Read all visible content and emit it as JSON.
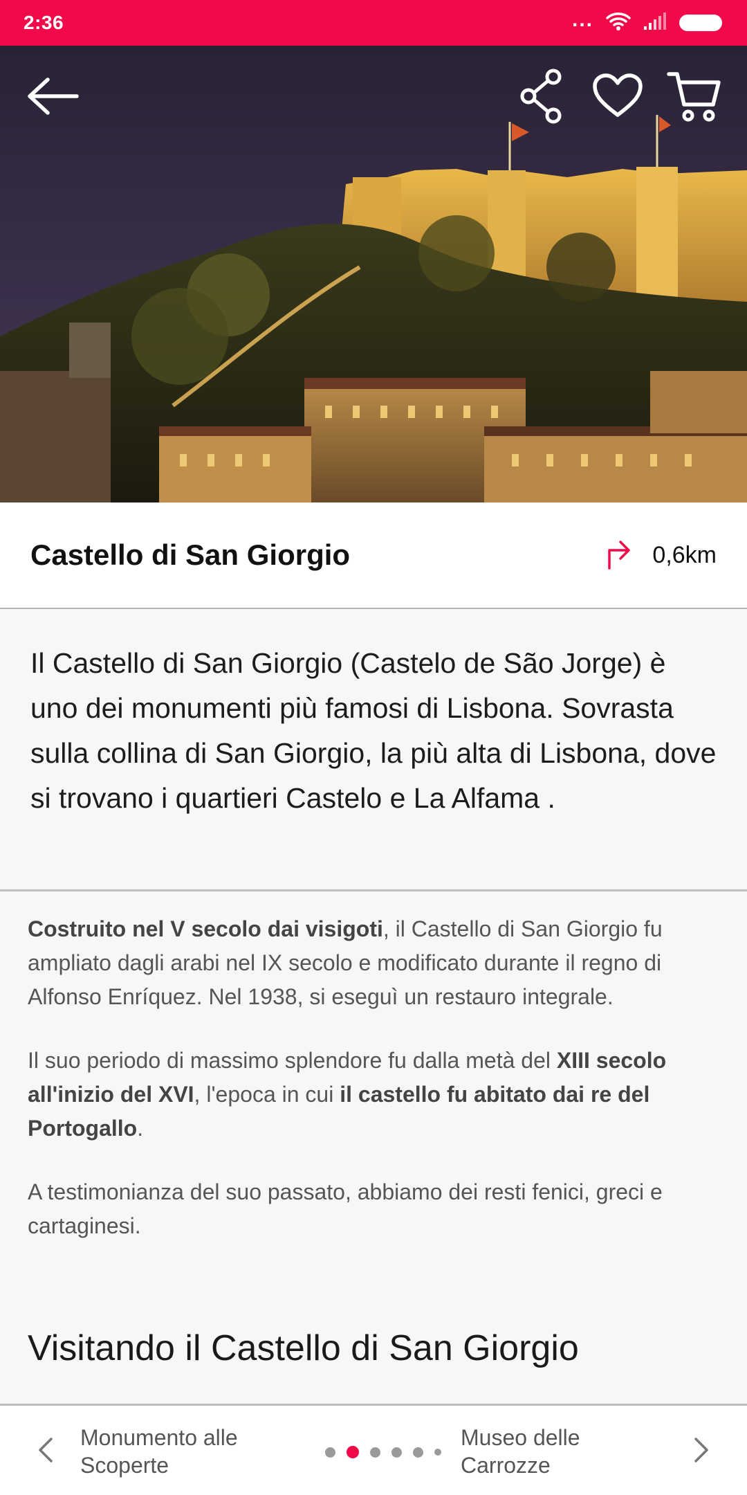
{
  "status_bar": {
    "time": "2:36",
    "dots": "...",
    "icons": [
      "wifi-icon",
      "signal-icon",
      "battery-icon"
    ],
    "color": "#f2094a"
  },
  "hero": {
    "image_alt": "Castello di San Giorgio at night",
    "actions": [
      "back-arrow-icon",
      "share-icon",
      "heart-icon",
      "cart-icon"
    ]
  },
  "place": {
    "title": "Castello di San Giorgio",
    "distance": "0,6km",
    "direction_icon": "turn-right-arrow-icon"
  },
  "intro": {
    "text": "Il Castello di San Giorgio  (Castelo de São Jorge) è uno dei monumenti più famosi di Lisbona. Sovrasta sulla collina di San Giorgio, la più alta di Lisbona, dove si trovano i  quartieri Castelo e  La Alfama ."
  },
  "body": {
    "p1_bold": "Costruito nel V secolo dai visigoti",
    "p1_rest": ", il Castello di San Giorgio fu ampliato dagli arabi nel IX secolo e modificato durante il regno di Alfonso Enríquez. Nel 1938, si eseguì un restauro integrale.",
    "p2_a": "Il suo periodo di massimo splendore fu dalla metà del ",
    "p2_b": "XIII secolo all'inizio del XVI",
    "p2_c": ", l'epoca in cui ",
    "p2_d": "il castello fu abitato dai re del Portogallo",
    "p2_e": ".",
    "p3": "A testimonianza del suo passato, abbiamo dei resti fenici, greci e cartaginesi."
  },
  "section": {
    "heading": "Visitando il Castello di San Giorgio"
  },
  "bottom_nav": {
    "prev_label": "Monumento alle Scoperte",
    "next_label": "Museo delle Carrozze",
    "page_count": 6,
    "active_index": 1,
    "accent": "#f2094a"
  }
}
